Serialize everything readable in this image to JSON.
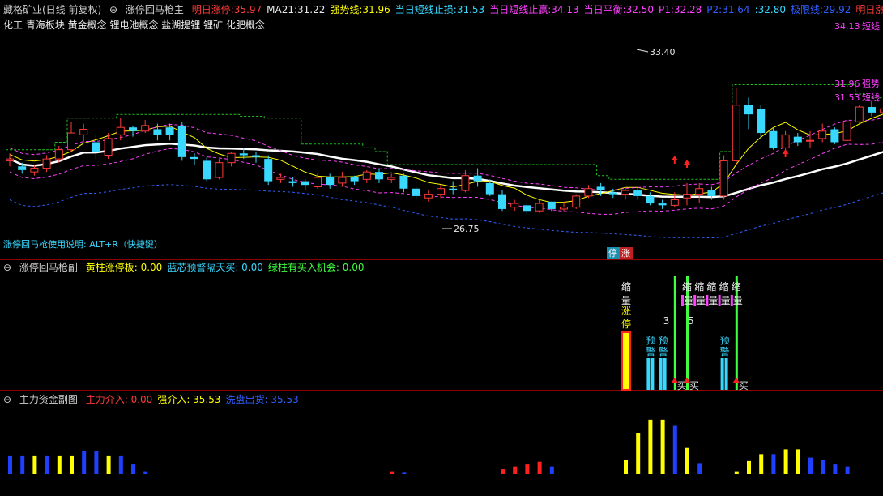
{
  "header": {
    "title": "藏格矿业(日线 前复权)",
    "indicator": "涨停回马枪主",
    "items": [
      {
        "label": "明日涨停:",
        "value": "35.97",
        "color": "#ff3b3b"
      },
      {
        "label": "MA21:",
        "value": "31.22",
        "color": "#e8e8e8"
      },
      {
        "label": "强势线:",
        "value": "31.96",
        "color": "#ffff00"
      },
      {
        "label": "当日短线止损:",
        "value": "31.53",
        "color": "#38d8ff"
      },
      {
        "label": "当日短线止赢:",
        "value": "34.13",
        "color": "#ff40ff"
      },
      {
        "label": "当日平衡:",
        "value": "32.50",
        "color": "#ff40ff"
      },
      {
        "label": "P1:",
        "value": "32.28",
        "color": "#ff40ff"
      },
      {
        "label": "P2:",
        "value": "31.64",
        "color": "#3060ff"
      },
      {
        "label": ":",
        "value": "32.80",
        "color": "#38d8ff"
      },
      {
        "label": "极限线:",
        "value": "29.92",
        "color": "#3060ff"
      },
      {
        "label": "明日涨◇",
        "value": "",
        "color": "#ff3b3b"
      }
    ]
  },
  "concepts": "化工 青海板块 黄金概念 锂电池概念 盐湖提锂 锂矿 化肥概念",
  "usage_note": "涨停回马枪使用说明: ALT+R（快捷键）",
  "chart_data": [
    {
      "type": "candlestick",
      "panel": "main",
      "ylim": [
        25.5,
        36.2
      ],
      "candles": [
        [
          29.5,
          29.6,
          29.2,
          29.9
        ],
        [
          29.2,
          29.0,
          28.8,
          29.4
        ],
        [
          28.9,
          29.1,
          28.7,
          29.3
        ],
        [
          29.1,
          29.6,
          28.9,
          29.8
        ],
        [
          29.6,
          30.1,
          29.4,
          30.3
        ],
        [
          30.1,
          31.0,
          30.0,
          31.6
        ],
        [
          30.9,
          31.2,
          30.5,
          31.5
        ],
        [
          30.5,
          30.0,
          29.6,
          30.9
        ],
        [
          29.8,
          30.7,
          29.6,
          31.0
        ],
        [
          30.9,
          31.3,
          30.6,
          31.8
        ],
        [
          31.3,
          31.1,
          30.8,
          31.4
        ],
        [
          31.1,
          31.4,
          31.0,
          31.7
        ],
        [
          31.2,
          30.9,
          30.6,
          31.5
        ],
        [
          31.3,
          30.9,
          30.6,
          31.5
        ],
        [
          31.4,
          29.7,
          29.5,
          31.6
        ],
        [
          29.7,
          29.6,
          29.3,
          29.9
        ],
        [
          29.5,
          28.5,
          28.4,
          29.7
        ],
        [
          28.6,
          29.4,
          28.5,
          29.6
        ],
        [
          29.4,
          29.9,
          29.2,
          30.0
        ],
        [
          29.9,
          29.8,
          29.6,
          30.2
        ],
        [
          29.8,
          29.7,
          29.4,
          30.0
        ],
        [
          29.6,
          28.4,
          28.2,
          29.8
        ],
        [
          28.5,
          28.6,
          28.3,
          28.8
        ],
        [
          28.4,
          28.3,
          28.1,
          28.6
        ],
        [
          28.4,
          28.2,
          27.9,
          28.5
        ],
        [
          28.1,
          28.6,
          28.0,
          28.8
        ],
        [
          28.6,
          28.2,
          28.0,
          28.8
        ],
        [
          28.3,
          28.6,
          28.1,
          28.9
        ],
        [
          28.6,
          28.4,
          28.2,
          28.7
        ],
        [
          28.5,
          28.9,
          28.3,
          29.0
        ],
        [
          28.9,
          28.5,
          28.3,
          29.1
        ],
        [
          28.5,
          28.6,
          28.3,
          28.8
        ],
        [
          28.7,
          28.0,
          27.8,
          28.8
        ],
        [
          28.0,
          27.6,
          27.4,
          28.1
        ],
        [
          27.5,
          27.7,
          27.3,
          27.9
        ],
        [
          27.7,
          28.0,
          27.5,
          28.2
        ],
        [
          28.0,
          27.9,
          27.7,
          28.4
        ],
        [
          27.9,
          28.7,
          27.8,
          29.0
        ],
        [
          28.7,
          28.4,
          28.1,
          29.1
        ],
        [
          28.3,
          27.7,
          27.6,
          28.5
        ],
        [
          27.7,
          26.9,
          26.8,
          27.9
        ],
        [
          27.0,
          27.2,
          26.8,
          27.4
        ],
        [
          27.1,
          26.8,
          26.6,
          27.2
        ],
        [
          26.8,
          27.2,
          26.7,
          27.4
        ],
        [
          27.3,
          26.9,
          26.8,
          27.3
        ],
        [
          26.9,
          27.0,
          26.8,
          27.3
        ],
        [
          27.0,
          27.6,
          26.9,
          27.7
        ],
        [
          27.6,
          28.0,
          27.5,
          28.2
        ],
        [
          28.1,
          27.9,
          27.6,
          28.3
        ],
        [
          27.8,
          27.7,
          27.5,
          28.0
        ],
        [
          27.7,
          27.9,
          27.4,
          28.1
        ],
        [
          27.9,
          27.6,
          27.4,
          28.1
        ],
        [
          27.6,
          27.2,
          27.1,
          27.8
        ],
        [
          27.2,
          27.1,
          26.9,
          27.4
        ],
        [
          27.1,
          27.4,
          27.0,
          27.8
        ],
        [
          27.5,
          27.7,
          27.1,
          28.3
        ],
        [
          27.7,
          28.0,
          27.2,
          28.3
        ],
        [
          27.9,
          27.6,
          27.4,
          28.1
        ],
        [
          27.6,
          29.5,
          27.4,
          29.8
        ],
        [
          29.5,
          32.5,
          29.3,
          33.4
        ],
        [
          32.5,
          32.0,
          31.2,
          32.9
        ],
        [
          32.3,
          31.0,
          30.8,
          32.5
        ],
        [
          31.1,
          30.2,
          30.1,
          31.3
        ],
        [
          30.2,
          30.9,
          30.0,
          31.1
        ],
        [
          30.8,
          30.5,
          30.3,
          31.0
        ],
        [
          30.6,
          30.6,
          30.2,
          31.1
        ],
        [
          30.7,
          31.1,
          30.5,
          31.5
        ],
        [
          31.2,
          30.5,
          30.4,
          31.3
        ],
        [
          30.6,
          31.6,
          30.5,
          31.7
        ],
        [
          31.6,
          32.4,
          31.5,
          32.5
        ],
        [
          32.4,
          32.1,
          31.9,
          32.7
        ],
        [
          32.1,
          32.3,
          31.9,
          32.6
        ],
        [
          32.3,
          32.4,
          32.1,
          32.7
        ],
        [
          32.4,
          32.9,
          32.2,
          33.0
        ],
        [
          32.9,
          32.4,
          32.3,
          33.1
        ],
        [
          32.4,
          32.7,
          32.1,
          33.0
        ],
        [
          32.7,
          32.5,
          31.7,
          33.0
        ],
        [
          32.5,
          32.9,
          32.3,
          33.1
        ],
        [
          32.9,
          32.7,
          32.5,
          33.0
        ]
      ],
      "annotations": [
        "33.40",
        "26.75"
      ],
      "right_labels": [
        {
          "text": "34.13",
          "color": "#ff40ff"
        },
        {
          "text": "短线",
          "color": "#ff40ff"
        },
        {
          "text": "31.96",
          "color": "#ff40ff"
        },
        {
          "text": "强势",
          "color": "#ff40ff"
        },
        {
          "text": "31.53",
          "color": "#ff40ff"
        },
        {
          "text": "短线",
          "color": "#ff40ff"
        }
      ],
      "badges": [
        "停",
        "涨"
      ]
    },
    {
      "type": "bar",
      "panel": "sub1",
      "title": "涨停回马枪副",
      "legend": [
        {
          "label": "黄柱涨停板:",
          "value": "0.00",
          "color": "#ffff00"
        },
        {
          "label": "蓝芯预警隔天买:",
          "value": "0.00",
          "color": "#38d8ff"
        },
        {
          "label": "绿柱有买入机会:",
          "value": "0.00",
          "color": "#40ff40"
        }
      ],
      "signal_labels": {
        "shrink": "缩",
        "volume": "量",
        "limit1": "涨",
        "limit2": "停",
        "warn1": "预",
        "warn2": "警",
        "buy": "买",
        "n3": "3",
        "n5": "5"
      }
    },
    {
      "type": "bar",
      "panel": "sub2",
      "title": "主力资金副图",
      "legend": [
        {
          "label": "主力介入:",
          "value": "0.00",
          "color": "#ff3b3b"
        },
        {
          "label": "强介入:",
          "value": "35.53",
          "color": "#ffff00"
        },
        {
          "label": "洗盘出货:",
          "value": "35.53",
          "color": "#3060ff"
        }
      ],
      "ylim": [
        0,
        10
      ],
      "values": [
        {
          "i": 0,
          "v": 2.6,
          "c": "blue"
        },
        {
          "i": 1,
          "v": 2.6,
          "c": "blue"
        },
        {
          "i": 2,
          "v": 2.6,
          "c": "yellow"
        },
        {
          "i": 3,
          "v": 2.6,
          "c": "blue"
        },
        {
          "i": 4,
          "v": 2.6,
          "c": "yellow"
        },
        {
          "i": 5,
          "v": 2.6,
          "c": "yellow"
        },
        {
          "i": 6,
          "v": 3.3,
          "c": "blue"
        },
        {
          "i": 7,
          "v": 3.3,
          "c": "blue"
        },
        {
          "i": 8,
          "v": 2.6,
          "c": "yellow"
        },
        {
          "i": 9,
          "v": 2.6,
          "c": "blue"
        },
        {
          "i": 10,
          "v": 1.4,
          "c": "blue"
        },
        {
          "i": 11,
          "v": 0.4,
          "c": "blue"
        },
        {
          "i": 31,
          "v": 0.4,
          "c": "red"
        },
        {
          "i": 32,
          "v": 0.2,
          "c": "blue"
        },
        {
          "i": 40,
          "v": 0.7,
          "c": "red"
        },
        {
          "i": 41,
          "v": 1.1,
          "c": "red"
        },
        {
          "i": 42,
          "v": 1.4,
          "c": "red"
        },
        {
          "i": 43,
          "v": 1.8,
          "c": "red"
        },
        {
          "i": 44,
          "v": 1.1,
          "c": "blue"
        },
        {
          "i": 50,
          "v": 2.0,
          "c": "yellow"
        },
        {
          "i": 51,
          "v": 6.0,
          "c": "yellow"
        },
        {
          "i": 52,
          "v": 7.9,
          "c": "yellow"
        },
        {
          "i": 53,
          "v": 7.9,
          "c": "yellow"
        },
        {
          "i": 54,
          "v": 7.0,
          "c": "blue"
        },
        {
          "i": 55,
          "v": 3.8,
          "c": "yellow"
        },
        {
          "i": 56,
          "v": 1.6,
          "c": "blue"
        },
        {
          "i": 59,
          "v": 0.4,
          "c": "yellow"
        },
        {
          "i": 60,
          "v": 1.9,
          "c": "yellow"
        },
        {
          "i": 61,
          "v": 2.9,
          "c": "yellow"
        },
        {
          "i": 62,
          "v": 2.9,
          "c": "blue"
        },
        {
          "i": 63,
          "v": 3.6,
          "c": "yellow"
        },
        {
          "i": 64,
          "v": 3.6,
          "c": "yellow"
        },
        {
          "i": 65,
          "v": 2.4,
          "c": "blue"
        },
        {
          "i": 66,
          "v": 2.1,
          "c": "blue"
        },
        {
          "i": 67,
          "v": 1.4,
          "c": "blue"
        },
        {
          "i": 68,
          "v": 1.1,
          "c": "blue"
        }
      ]
    }
  ],
  "colors": {
    "up": "#ff3b3b",
    "down": "#38d8ff",
    "bg": "#000000",
    "grid": "#8b0000"
  }
}
